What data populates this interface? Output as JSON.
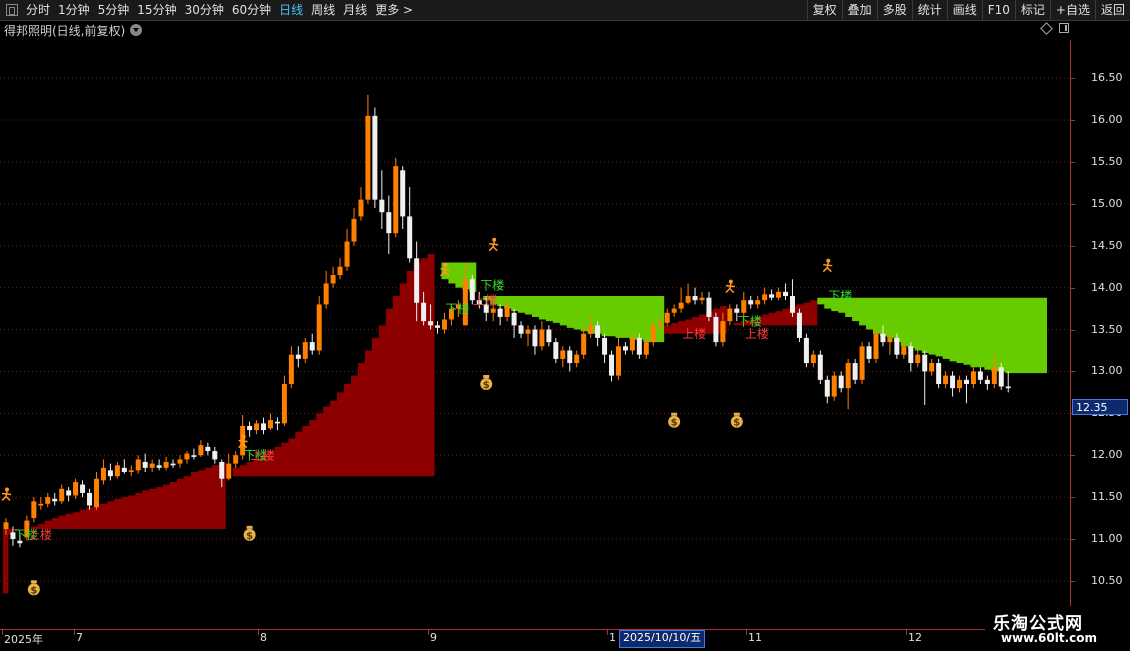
{
  "toolbar": {
    "periods": [
      "分时",
      "1分钟",
      "5分钟",
      "15分钟",
      "30分钟",
      "60分钟",
      "日线",
      "周线",
      "月线",
      "更多 >"
    ],
    "active_period": "日线",
    "right_buttons": [
      "复权",
      "叠加",
      "多股",
      "统计",
      "画线",
      "F10",
      "标记",
      "+自选",
      "返回"
    ]
  },
  "header": {
    "title": "得邦照明(日线,前复权)"
  },
  "colors": {
    "up": "#ff8000",
    "down": "#f0f0f0",
    "band_red": "#8e0000",
    "band_green": "#66cc00",
    "grid": "#7a1515",
    "axis": "#a83232",
    "label_green": "#33dd33",
    "label_red": "#ff3b3b"
  },
  "price_axis": {
    "ticks": [
      "16.50",
      "16.00",
      "15.50",
      "15.00",
      "14.50",
      "14.00",
      "13.50",
      "13.00",
      "12.50",
      "12.00",
      "11.50",
      "11.00",
      "10.50"
    ],
    "current_price": "12.35"
  },
  "time_axis": {
    "labels": [
      "2025年",
      "7",
      "8",
      "9",
      "1",
      "11",
      "12"
    ],
    "highlight_date": "2025/10/10/五"
  },
  "markers": {
    "down_label": "下楼",
    "up_label": "上楼",
    "runner_icon": "runner-icon",
    "money_icon": "money-bag-icon",
    "money_glyph": "$"
  },
  "watermark": {
    "title": "乐淘公式网",
    "url": "www.60lt.com"
  },
  "chart_data": {
    "type": "candlestick",
    "ylim": [
      10.1,
      16.8
    ],
    "y_ticks": [
      16.5,
      16.0,
      15.5,
      15.0,
      14.5,
      14.0,
      13.5,
      13.0,
      12.5,
      12.0,
      11.5,
      11.0,
      10.5
    ],
    "candles": [
      [
        11.12,
        11.2,
        11.25,
        11.05
      ],
      [
        11.08,
        11.0,
        11.15,
        10.92
      ],
      [
        10.98,
        10.95,
        11.05,
        10.9
      ],
      [
        11.02,
        11.22,
        11.28,
        10.98
      ],
      [
        11.25,
        11.45,
        11.5,
        11.2
      ],
      [
        11.4,
        11.42,
        11.5,
        11.35
      ],
      [
        11.42,
        11.5,
        11.55,
        11.38
      ],
      [
        11.48,
        11.45,
        11.55,
        11.4
      ],
      [
        11.45,
        11.6,
        11.65,
        11.42
      ],
      [
        11.58,
        11.52,
        11.62,
        11.45
      ],
      [
        11.52,
        11.68,
        11.72,
        11.48
      ],
      [
        11.65,
        11.55,
        11.7,
        11.5
      ],
      [
        11.55,
        11.4,
        11.6,
        11.35
      ],
      [
        11.38,
        11.72,
        11.8,
        11.35
      ],
      [
        11.7,
        11.85,
        11.95,
        11.65
      ],
      [
        11.82,
        11.75,
        11.9,
        11.7
      ],
      [
        11.75,
        11.88,
        11.92,
        11.72
      ],
      [
        11.85,
        11.8,
        11.95,
        11.78
      ],
      [
        11.8,
        11.82,
        11.88,
        11.75
      ],
      [
        11.82,
        11.95,
        12.0,
        11.78
      ],
      [
        11.92,
        11.85,
        12.02,
        11.8
      ],
      [
        11.85,
        11.9,
        11.95,
        11.8
      ],
      [
        11.88,
        11.85,
        11.95,
        11.82
      ],
      [
        11.85,
        11.92,
        11.98,
        11.82
      ],
      [
        11.9,
        11.88,
        11.95,
        11.85
      ],
      [
        11.9,
        11.95,
        12.0,
        11.85
      ],
      [
        11.95,
        12.02,
        12.05,
        11.9
      ],
      [
        12.0,
        11.98,
        12.08,
        11.95
      ],
      [
        12.0,
        12.12,
        12.18,
        11.98
      ],
      [
        12.1,
        12.05,
        12.15,
        12.0
      ],
      [
        12.05,
        11.95,
        12.1,
        11.9
      ],
      [
        11.92,
        11.72,
        11.95,
        11.62
      ],
      [
        11.72,
        11.9,
        12.02,
        11.7
      ],
      [
        11.9,
        12.0,
        12.05,
        11.85
      ],
      [
        12.0,
        12.35,
        12.48,
        11.95
      ],
      [
        12.35,
        12.3,
        12.4,
        12.22
      ],
      [
        12.3,
        12.38,
        12.42,
        12.25
      ],
      [
        12.38,
        12.3,
        12.45,
        12.25
      ],
      [
        12.32,
        12.42,
        12.5,
        12.3
      ],
      [
        12.4,
        12.38,
        12.45,
        12.3
      ],
      [
        12.38,
        12.85,
        12.95,
        12.35
      ],
      [
        12.85,
        13.2,
        13.3,
        12.8
      ],
      [
        13.2,
        13.15,
        13.3,
        13.05
      ],
      [
        13.15,
        13.35,
        13.4,
        13.1
      ],
      [
        13.35,
        13.25,
        13.45,
        13.2
      ],
      [
        13.25,
        13.8,
        13.9,
        13.2
      ],
      [
        13.8,
        14.05,
        14.2,
        13.75
      ],
      [
        14.05,
        14.15,
        14.25,
        14.0
      ],
      [
        14.15,
        14.25,
        14.35,
        14.1
      ],
      [
        14.25,
        14.55,
        14.7,
        14.2
      ],
      [
        14.55,
        14.82,
        14.95,
        14.5
      ],
      [
        14.85,
        15.05,
        15.2,
        14.8
      ],
      [
        15.05,
        16.05,
        16.3,
        15.0
      ],
      [
        16.05,
        15.05,
        16.15,
        14.95
      ],
      [
        15.05,
        14.9,
        15.4,
        14.7
      ],
      [
        14.9,
        14.65,
        15.1,
        14.4
      ],
      [
        14.65,
        15.45,
        15.55,
        14.6
      ],
      [
        15.4,
        14.85,
        15.45,
        14.7
      ],
      [
        14.85,
        14.35,
        15.2,
        14.3
      ],
      [
        14.35,
        13.82,
        14.55,
        13.6
      ],
      [
        13.82,
        13.6,
        13.95,
        13.55
      ],
      [
        13.6,
        13.55,
        13.8,
        13.5
      ],
      [
        13.55,
        13.52,
        13.6,
        13.45
      ],
      [
        13.5,
        13.62,
        13.7,
        13.45
      ],
      [
        13.62,
        13.75,
        13.8,
        13.55
      ],
      [
        13.75,
        13.8,
        13.85,
        13.65
      ],
      [
        13.55,
        14.1,
        14.3,
        13.55
      ],
      [
        14.1,
        13.85,
        14.15,
        13.8
      ],
      [
        13.85,
        13.8,
        13.95,
        13.75
      ],
      [
        13.8,
        13.7,
        13.9,
        13.6
      ],
      [
        13.7,
        13.75,
        13.8,
        13.6
      ],
      [
        13.75,
        13.65,
        13.8,
        13.55
      ],
      [
        13.65,
        13.78,
        13.85,
        13.6
      ],
      [
        13.7,
        13.55,
        13.75,
        13.4
      ],
      [
        13.55,
        13.45,
        13.6,
        13.4
      ],
      [
        13.45,
        13.5,
        13.55,
        13.3
      ],
      [
        13.5,
        13.3,
        13.55,
        13.2
      ],
      [
        13.3,
        13.5,
        13.6,
        13.25
      ],
      [
        13.5,
        13.35,
        13.55,
        13.3
      ],
      [
        13.35,
        13.15,
        13.4,
        13.1
      ],
      [
        13.15,
        13.25,
        13.3,
        13.05
      ],
      [
        13.25,
        13.1,
        13.3,
        13.0
      ],
      [
        13.1,
        13.2,
        13.25,
        13.05
      ],
      [
        13.2,
        13.45,
        13.55,
        13.15
      ],
      [
        13.45,
        13.55,
        13.65,
        13.4
      ],
      [
        13.55,
        13.4,
        13.6,
        13.3
      ],
      [
        13.4,
        13.2,
        13.45,
        13.1
      ],
      [
        13.2,
        12.95,
        13.25,
        12.88
      ],
      [
        12.95,
        13.3,
        13.4,
        12.9
      ],
      [
        13.3,
        13.25,
        13.35,
        13.2
      ],
      [
        13.25,
        13.4,
        13.45,
        13.2
      ],
      [
        13.4,
        13.2,
        13.45,
        13.15
      ],
      [
        13.2,
        13.35,
        13.4,
        13.15
      ],
      [
        13.35,
        13.55,
        13.6,
        13.3
      ],
      [
        13.55,
        13.58,
        13.65,
        13.5
      ],
      [
        13.58,
        13.7,
        13.75,
        13.55
      ],
      [
        13.7,
        13.75,
        13.8,
        13.65
      ],
      [
        13.75,
        13.82,
        14.0,
        13.7
      ],
      [
        13.82,
        13.9,
        14.05,
        13.8
      ],
      [
        13.9,
        13.85,
        14.0,
        13.8
      ],
      [
        13.85,
        13.88,
        13.95,
        13.8
      ],
      [
        13.88,
        13.65,
        13.95,
        13.6
      ],
      [
        13.65,
        13.35,
        13.7,
        13.3
      ],
      [
        13.35,
        13.6,
        13.7,
        13.3
      ],
      [
        13.6,
        13.75,
        13.8,
        13.55
      ],
      [
        13.75,
        13.7,
        13.8,
        13.6
      ],
      [
        13.7,
        13.85,
        13.95,
        13.65
      ],
      [
        13.85,
        13.8,
        13.9,
        13.75
      ],
      [
        13.8,
        13.85,
        13.9,
        13.75
      ],
      [
        13.85,
        13.92,
        14.0,
        13.8
      ],
      [
        13.92,
        13.88,
        13.98,
        13.85
      ],
      [
        13.88,
        13.95,
        14.0,
        13.85
      ],
      [
        13.95,
        13.9,
        14.05,
        13.85
      ],
      [
        13.9,
        13.7,
        14.1,
        13.65
      ],
      [
        13.7,
        13.4,
        13.75,
        13.35
      ],
      [
        13.4,
        13.1,
        13.45,
        13.05
      ],
      [
        13.1,
        13.2,
        13.25,
        13.05
      ],
      [
        13.2,
        12.9,
        13.25,
        12.85
      ],
      [
        12.9,
        12.7,
        12.95,
        12.62
      ],
      [
        12.7,
        12.95,
        13.0,
        12.65
      ],
      [
        12.95,
        12.8,
        13.0,
        12.75
      ],
      [
        12.8,
        13.1,
        13.15,
        12.55
      ],
      [
        13.1,
        12.9,
        13.15,
        12.85
      ],
      [
        12.9,
        13.3,
        13.35,
        12.85
      ],
      [
        13.3,
        13.15,
        13.35,
        13.1
      ],
      [
        13.15,
        13.45,
        13.5,
        13.1
      ],
      [
        13.45,
        13.35,
        13.55,
        13.3
      ],
      [
        13.35,
        13.4,
        13.45,
        13.2
      ],
      [
        13.4,
        13.2,
        13.45,
        13.15
      ],
      [
        13.2,
        13.3,
        13.35,
        13.15
      ],
      [
        13.3,
        13.1,
        13.35,
        13.0
      ],
      [
        13.1,
        13.2,
        13.25,
        13.05
      ],
      [
        13.2,
        13.0,
        13.25,
        12.6
      ],
      [
        13.0,
        13.1,
        13.15,
        12.95
      ],
      [
        13.1,
        12.85,
        13.15,
        12.8
      ],
      [
        12.85,
        12.95,
        13.0,
        12.8
      ],
      [
        12.95,
        12.8,
        13.0,
        12.7
      ],
      [
        12.8,
        12.9,
        12.95,
        12.75
      ],
      [
        12.9,
        12.85,
        12.95,
        12.62
      ],
      [
        12.85,
        13.0,
        13.05,
        12.8
      ],
      [
        13.0,
        12.9,
        13.05,
        12.85
      ],
      [
        12.9,
        12.85,
        12.95,
        12.78
      ],
      [
        12.85,
        13.05,
        13.2,
        12.8
      ],
      [
        13.05,
        12.82,
        13.1,
        12.78
      ],
      [
        12.82,
        12.8,
        13.0,
        12.75
      ]
    ],
    "band_segments": [
      {
        "from": 0,
        "to": 3,
        "values": [
          10.35,
          11.05,
          11.1,
          11.12
        ],
        "color": "red"
      },
      {
        "from": 3,
        "to": 32,
        "values": [
          11.12,
          11.15,
          11.18,
          11.22,
          11.25,
          11.28,
          11.3,
          11.32,
          11.35,
          11.38,
          11.4,
          11.42,
          11.45,
          11.48,
          11.5,
          11.52,
          11.55,
          11.58,
          11.6,
          11.62,
          11.65,
          11.68,
          11.72,
          11.75,
          11.8,
          11.82,
          11.85,
          11.88,
          11.92
        ],
        "color": "red",
        "base": 11.12
      },
      {
        "from": 33,
        "to": 62,
        "values": [
          11.85,
          11.88,
          11.92,
          11.95,
          12.0,
          12.05,
          12.1,
          12.15,
          12.2,
          12.28,
          12.35,
          12.42,
          12.5,
          12.58,
          12.65,
          12.75,
          12.85,
          12.95,
          13.1,
          13.25,
          13.4,
          13.55,
          13.75,
          13.9,
          14.05,
          14.2,
          14.3,
          14.35,
          14.4
        ],
        "color": "red",
        "base": 11.75
      },
      {
        "from": 62,
        "to": 68,
        "values": [
          14.3,
          14.1,
          14.05,
          14.0,
          13.98,
          13.95
        ],
        "color": "green",
        "base": 14.3
      },
      {
        "from": 68,
        "to": 95,
        "values": [
          13.9,
          13.85,
          13.8,
          13.78,
          13.75,
          13.72,
          13.7,
          13.68,
          13.65,
          13.62,
          13.6,
          13.58,
          13.55,
          13.52,
          13.5,
          13.48,
          13.45,
          13.45,
          13.42,
          13.42,
          13.4,
          13.4,
          13.38,
          13.38,
          13.35,
          13.35,
          13.35
        ],
        "color": "green",
        "base": 13.9
      },
      {
        "from": 95,
        "to": 104,
        "values": [
          13.55,
          13.58,
          13.6,
          13.62,
          13.65,
          13.68,
          13.72,
          13.75,
          13.78
        ],
        "color": "red",
        "base": 13.45
      },
      {
        "from": 104,
        "to": 117,
        "values": [
          13.55,
          13.58,
          13.6,
          13.62,
          13.65,
          13.68,
          13.7,
          13.72,
          13.75,
          13.78,
          13.8,
          13.82,
          13.85
        ],
        "color": "red",
        "base": 13.55
      },
      {
        "from": 117,
        "to": 150,
        "values": [
          13.8,
          13.75,
          13.72,
          13.7,
          13.65,
          13.6,
          13.55,
          13.5,
          13.45,
          13.42,
          13.4,
          13.35,
          13.3,
          13.28,
          13.25,
          13.22,
          13.2,
          13.18,
          13.15,
          13.12,
          13.1,
          13.08,
          13.05,
          13.05,
          13.02,
          13.0,
          13.0,
          12.98,
          12.98,
          12.98,
          12.98,
          12.98,
          12.98
        ],
        "color": "green",
        "base": 13.88
      }
    ],
    "signals": [
      {
        "i": 0,
        "type": "runner",
        "price": 11.52
      },
      {
        "i": 2,
        "type": "down",
        "price": 11.0
      },
      {
        "i": 4,
        "type": "up",
        "price": 11.0
      },
      {
        "i": 4,
        "type": "money",
        "price": 10.4
      },
      {
        "i": 34,
        "type": "runner",
        "price": 12.15
      },
      {
        "i": 35,
        "type": "down",
        "price": 11.95
      },
      {
        "i": 36,
        "type": "up",
        "price": 11.95
      },
      {
        "i": 35,
        "type": "money",
        "price": 11.05
      },
      {
        "i": 63,
        "type": "runner",
        "price": 14.2
      },
      {
        "i": 64,
        "type": "down",
        "price": 13.7
      },
      {
        "i": 68,
        "type": "up",
        "price": 13.8
      },
      {
        "i": 69,
        "type": "down",
        "price": 13.98
      },
      {
        "i": 70,
        "type": "runner",
        "price": 14.5
      },
      {
        "i": 69,
        "type": "money",
        "price": 12.85
      },
      {
        "i": 96,
        "type": "money",
        "price": 12.4
      },
      {
        "i": 98,
        "type": "up",
        "price": 13.4
      },
      {
        "i": 104,
        "type": "runner",
        "price": 14.0
      },
      {
        "i": 106,
        "type": "down",
        "price": 13.55
      },
      {
        "i": 107,
        "type": "up",
        "price": 13.4
      },
      {
        "i": 105,
        "type": "money",
        "price": 12.4
      },
      {
        "i": 118,
        "type": "runner",
        "price": 14.25
      },
      {
        "i": 119,
        "type": "down",
        "price": 13.85
      }
    ]
  }
}
